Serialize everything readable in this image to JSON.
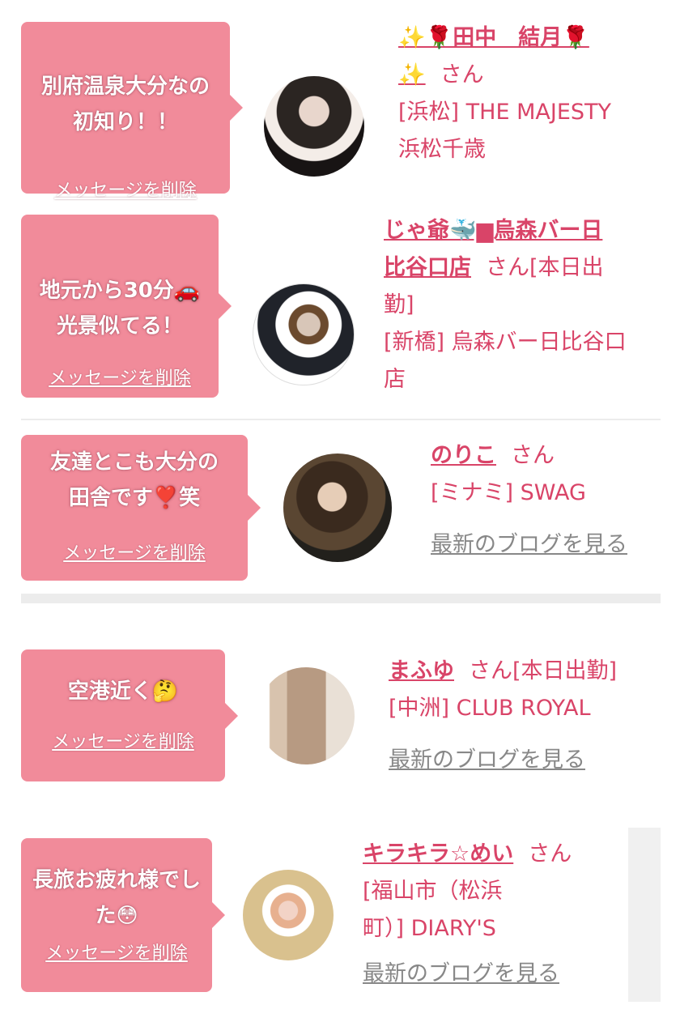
{
  "delete_label": "メッセージを削除",
  "blog_label": "最新のブログを見る",
  "san": "さん",
  "entries": [
    {
      "message": [
        "別府温泉大分なの",
        "初知り！！"
      ],
      "name_lines": [
        "✨🌹田中　結月🌹",
        "✨"
      ],
      "status": "",
      "shop_lines": [
        "[浜松] THE MAJESTY",
        "浜松千歳"
      ]
    },
    {
      "message": [
        "地元から30分🚗",
        "光景似てる！"
      ],
      "name_lines": [
        "じゃ爺🐳▆烏森バー日",
        "比谷口店"
      ],
      "status": "[本日出",
      "status2": "勤]",
      "shop_lines": [
        "[新橋] 烏森バー日比谷口",
        "店"
      ]
    },
    {
      "message": [
        "友達とこも大分の",
        "田舎です❣️笑"
      ],
      "name_lines": [
        "のりこ"
      ],
      "status": "",
      "shop_lines": [
        "[ミナミ] SWAG"
      ]
    },
    {
      "message": [
        "空港近く🤔"
      ],
      "name_lines": [
        "まふゆ"
      ],
      "status": "[本日出勤]",
      "shop_lines": [
        "[中洲] CLUB ROYAL"
      ]
    },
    {
      "message": [
        "長旅お疲れ様でし",
        "た😳"
      ],
      "name_lines": [
        "キラキラ☆めい"
      ],
      "status": "",
      "shop_lines": [
        "[福山市（松浜",
        "町）] DIARY'S"
      ]
    }
  ],
  "colors": {
    "bubble": "#f18b9a",
    "accent": "#d94468",
    "muted": "#888888"
  }
}
